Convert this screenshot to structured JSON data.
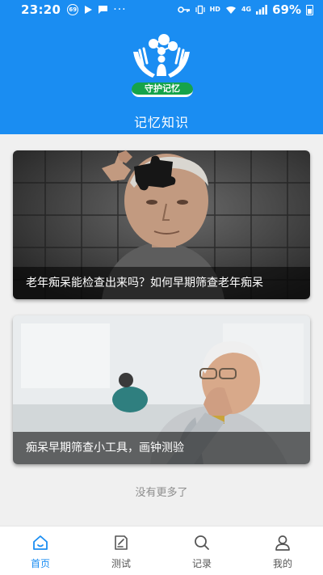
{
  "status_bar": {
    "time": "23:20",
    "notif_badge": "69",
    "network_tag_top": "HD",
    "network_tag_4g": "4G",
    "battery": "69%"
  },
  "header": {
    "logo_text": "守护记忆",
    "title": "记忆知识"
  },
  "articles": [
    {
      "title": "老年痴呆能检查出来吗？如何早期筛查老年痴呆"
    },
    {
      "title": "痴呆早期筛查小工具，画钟测验"
    }
  ],
  "list_end_text": "没有更多了",
  "bottom_nav": {
    "items": [
      {
        "label": "首页",
        "icon": "home-icon",
        "active": true
      },
      {
        "label": "测试",
        "icon": "test-icon",
        "active": false
      },
      {
        "label": "记录",
        "icon": "search-icon",
        "active": false
      },
      {
        "label": "我的",
        "icon": "user-icon",
        "active": false
      }
    ]
  },
  "colors": {
    "primary": "#1a8df2",
    "logo_green": "#16a34a",
    "muted_text": "#8d8d8d"
  }
}
